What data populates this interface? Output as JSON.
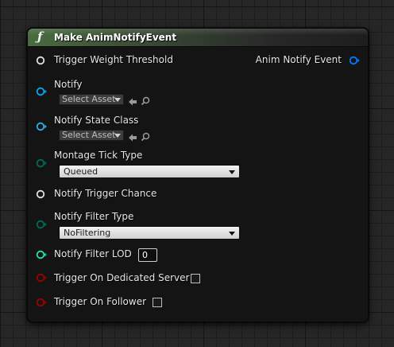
{
  "node": {
    "title": "Make AnimNotifyEvent",
    "icon": "function-icon",
    "header_color": "#4a6b3f"
  },
  "pins": {
    "trigger_weight_threshold": {
      "label": "Trigger Weight Threshold",
      "color": "#e0e0e0",
      "icon": "float-pin-icon"
    },
    "notify": {
      "label": "Notify",
      "value": "Select Asset",
      "color": "#00a8f2",
      "icon": "object-pin-icon"
    },
    "notify_state_class": {
      "label": "Notify State Class",
      "value": "Select Asset",
      "color": "#2fb0e8",
      "icon": "class-pin-icon"
    },
    "montage_tick_type": {
      "label": "Montage Tick Type",
      "value": "Queued",
      "color": "#006b5c",
      "icon": "enum-pin-icon"
    },
    "notify_trigger_chance": {
      "label": "Notify Trigger Chance",
      "color": "#e0e0e0",
      "icon": "float-pin-icon"
    },
    "notify_filter_type": {
      "label": "Notify Filter Type",
      "value": "NoFiltering",
      "color": "#006b5c",
      "icon": "enum-pin-icon"
    },
    "notify_filter_lod": {
      "label": "Notify Filter LOD",
      "value": "0",
      "color": "#20e0b0",
      "icon": "int-pin-icon"
    },
    "trigger_on_dedicated_server": {
      "label": "Trigger On Dedicated Server",
      "checked": false,
      "color": "#a00000",
      "icon": "bool-pin-icon"
    },
    "trigger_on_follower": {
      "label": "Trigger On Follower",
      "checked": false,
      "color": "#a00000",
      "icon": "bool-pin-icon"
    }
  },
  "output": {
    "label": "Anim Notify Event",
    "color": "#0078ff",
    "icon": "struct-pin-icon"
  }
}
